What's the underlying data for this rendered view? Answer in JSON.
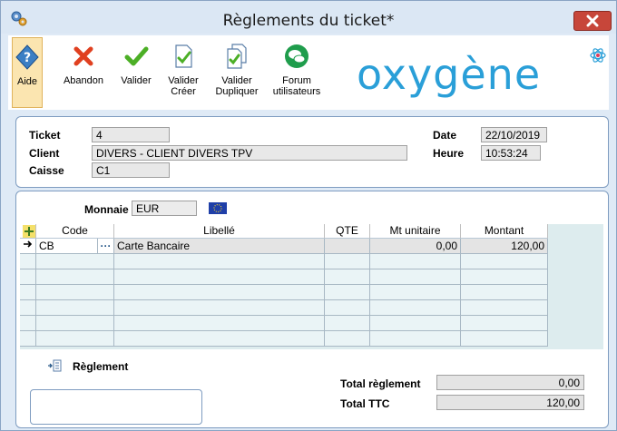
{
  "window": {
    "title": "Règlements du ticket*"
  },
  "toolbar": {
    "buttons": [
      {
        "id": "aide",
        "label": "Aide",
        "icon": "help-icon"
      },
      {
        "id": "abandon",
        "label": "Abandon",
        "icon": "cross-icon"
      },
      {
        "id": "valider",
        "label": "Valider",
        "icon": "check-icon"
      },
      {
        "id": "valider-creer",
        "label": "Valider\nCréer",
        "icon": "doc-check-icon"
      },
      {
        "id": "valider-dupliquer",
        "label": "Valider\nDupliquer",
        "icon": "doc-copy-check-icon"
      },
      {
        "id": "forum",
        "label": "Forum\nutilisateurs",
        "icon": "forum-icon"
      }
    ],
    "logo": "oxygène"
  },
  "info": {
    "ticket_label": "Ticket",
    "ticket": "4",
    "client_label": "Client",
    "client": "DIVERS - CLIENT DIVERS TPV",
    "caisse_label": "Caisse",
    "caisse": "C1",
    "date_label": "Date",
    "date": "22/10/2019",
    "heure_label": "Heure",
    "heure": "10:53:24"
  },
  "monnaie": {
    "label": "Monnaie",
    "value": "EUR",
    "flag": "eu-flag-icon"
  },
  "grid": {
    "columns": [
      "Code",
      "Libellé",
      "QTE",
      "Mt unitaire",
      "Montant"
    ],
    "rows": [
      {
        "code": "CB",
        "libelle": "Carte Bancaire",
        "qte": "",
        "mt_unitaire": "0,00",
        "montant": "120,00"
      }
    ]
  },
  "reglement": {
    "label": "Règlement"
  },
  "totals": {
    "total_reglement_label": "Total règlement",
    "total_reglement": "0,00",
    "total_ttc_label": "Total TTC",
    "total_ttc": "120,00"
  },
  "colors": {
    "accent": "#2a9fd8",
    "close": "#c7463a"
  }
}
